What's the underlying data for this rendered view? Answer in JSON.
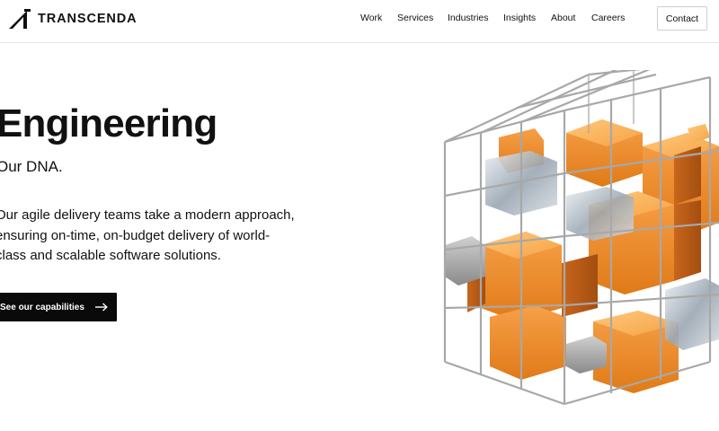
{
  "header": {
    "logo_text": "TRANSCENDA",
    "nav": {
      "work": "Work",
      "services": "Services",
      "industries": "Industries",
      "insights": "Insights",
      "about": "About",
      "careers": "Careers"
    },
    "contact_label": "Contact"
  },
  "hero": {
    "title": "Engineering",
    "subtitle": "Our DNA.",
    "body_lines": [
      "Our agile delivery teams take a modern approach,",
      "ensuring on-time, on-budget delivery of world-",
      "class and scalable software solutions."
    ],
    "cta_label": "See our capabilities"
  },
  "icons": {
    "logo": "logo-mark-icon",
    "cta": "arrow-right-icon",
    "illustration": "cube-grid-illustration"
  },
  "colors": {
    "text": "#111111",
    "cta_background": "#0a0a0a",
    "accent_orange": "#f08a24",
    "frame_gray": "#9a9a9a"
  }
}
